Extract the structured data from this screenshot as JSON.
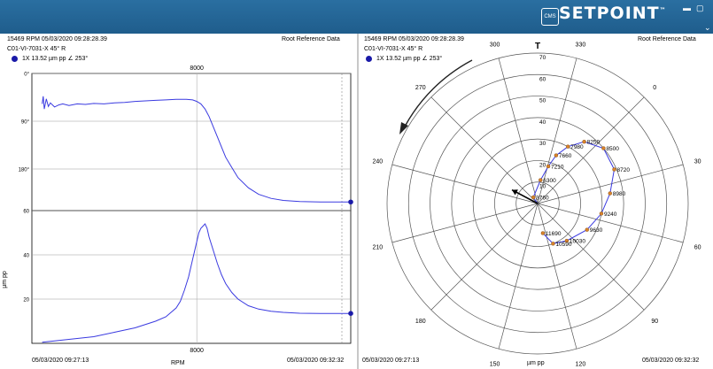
{
  "app": {
    "logo_text": "SETPOINT",
    "logo_trademark": "™",
    "cms_badge": "CMS",
    "colors": {
      "header_bg": "#1f5d8c",
      "trace": "#3a3ae0",
      "marker": "#1a1aa8",
      "polar_point": "#d9822b"
    }
  },
  "left_panel": {
    "status_line": "15469 RPM   05/03/2020 09:28:28.39",
    "reference": "Root Reference Data",
    "point_name": "C01-VI-7031-X 45° R",
    "legend": "1X 13.52 µm pp ∠ 253°",
    "time_start": "05/03/2020 09:27:13",
    "time_end": "05/03/2020 09:32:32",
    "x_axis_label": "RPM",
    "y_axis_amp_label": "µm pp"
  },
  "right_panel": {
    "status_line": "15469 RPM   05/03/2020 09:28:28.39",
    "reference": "Root Reference Data",
    "point_name": "C01-VI-7031-X 45° R",
    "legend": "1X 13.52 µm pp ∠ 253°",
    "time_start": "05/03/2020 09:27:13",
    "time_end": "05/03/2020 09:32:32",
    "unit_label": "µm pp",
    "top_marker": "T"
  },
  "chart_data": [
    {
      "type": "line",
      "name": "bode-phase",
      "x_ticks": [
        "8000"
      ],
      "y_ticks": [
        "0°",
        "90°",
        "180°"
      ],
      "xlim": [
        0,
        15469
      ],
      "ylim": [
        0,
        270
      ],
      "y_inverted": true,
      "x": [
        500,
        550,
        600,
        700,
        800,
        900,
        1100,
        1300,
        1500,
        1800,
        2200,
        2600,
        3000,
        3500,
        4000,
        4500,
        5000,
        5500,
        6000,
        6500,
        7000,
        7500,
        7800,
        8000,
        8200,
        8400,
        8600,
        8800,
        9000,
        9200,
        9400,
        9700,
        10000,
        10500,
        11000,
        11600,
        12200,
        13000,
        14000,
        15000,
        15469
      ],
      "y": [
        60,
        45,
        70,
        50,
        65,
        58,
        66,
        62,
        60,
        63,
        60,
        61,
        59,
        60,
        58,
        57,
        55,
        54,
        53,
        52,
        51,
        51,
        52,
        55,
        60,
        70,
        85,
        105,
        125,
        145,
        165,
        185,
        205,
        225,
        238,
        246,
        250,
        252,
        253,
        253,
        253
      ]
    },
    {
      "type": "line",
      "name": "bode-amplitude",
      "ylabel": "µm pp",
      "x_ticks": [
        "8000"
      ],
      "y_ticks": [
        "60",
        "40",
        "20"
      ],
      "xlim": [
        0,
        15469
      ],
      "ylim": [
        0,
        60
      ],
      "x": [
        500,
        1000,
        2000,
        3000,
        4000,
        5000,
        6000,
        6500,
        7000,
        7200,
        7400,
        7600,
        7800,
        8000,
        8100,
        8200,
        8300,
        8400,
        8500,
        8600,
        8800,
        9000,
        9200,
        9400,
        9700,
        10000,
        10500,
        11000,
        11600,
        12200,
        13000,
        14000,
        15000,
        15469
      ],
      "y": [
        0.5,
        1,
        2,
        3,
        5,
        7,
        10,
        12,
        16,
        19,
        24,
        30,
        38,
        46,
        50,
        52,
        53,
        54,
        52,
        48,
        42,
        36,
        31,
        27,
        23,
        20,
        17,
        15.5,
        14.5,
        14,
        13.6,
        13.5,
        13.5,
        13.52
      ]
    },
    {
      "type": "polar",
      "name": "polar-plot",
      "amplitude_ticks": [
        "10",
        "20",
        "30",
        "40",
        "50",
        "60",
        "70"
      ],
      "angle_labels": [
        "0",
        "30",
        "60",
        "90",
        "120",
        "150",
        "180",
        "210",
        "240",
        "270",
        "300",
        "330"
      ],
      "rmax": 70,
      "rotation": "counter-clockwise",
      "angle_label_offset": 45,
      "points": [
        {
          "rpm": 3760,
          "amp": 3.5,
          "ang": 280
        },
        {
          "rpm": 6300,
          "amp": 11,
          "ang": 322
        },
        {
          "rpm": 7210,
          "amp": 18,
          "ang": 331
        },
        {
          "rpm": 7660,
          "amp": 24,
          "ang": 336
        },
        {
          "rpm": 7980,
          "amp": 30,
          "ang": 343
        },
        {
          "rpm": 8250,
          "amp": 36,
          "ang": 352
        },
        {
          "rpm": 8500,
          "amp": 40,
          "ang": 365
        },
        {
          "rpm": 8720,
          "amp": 39,
          "ang": 381
        },
        {
          "rpm": 8980,
          "amp": 34,
          "ang": 397
        },
        {
          "rpm": 9240,
          "amp": 30,
          "ang": 414
        },
        {
          "rpm": 9630,
          "amp": 26,
          "ang": 433
        },
        {
          "rpm": 10030,
          "amp": 22,
          "ang": 457
        },
        {
          "rpm": 10590,
          "amp": 20,
          "ang": 474
        },
        {
          "rpm": 11690,
          "amp": 14,
          "ang": 485
        }
      ],
      "current": {
        "amp": 13.52,
        "ang": 253
      }
    }
  ]
}
